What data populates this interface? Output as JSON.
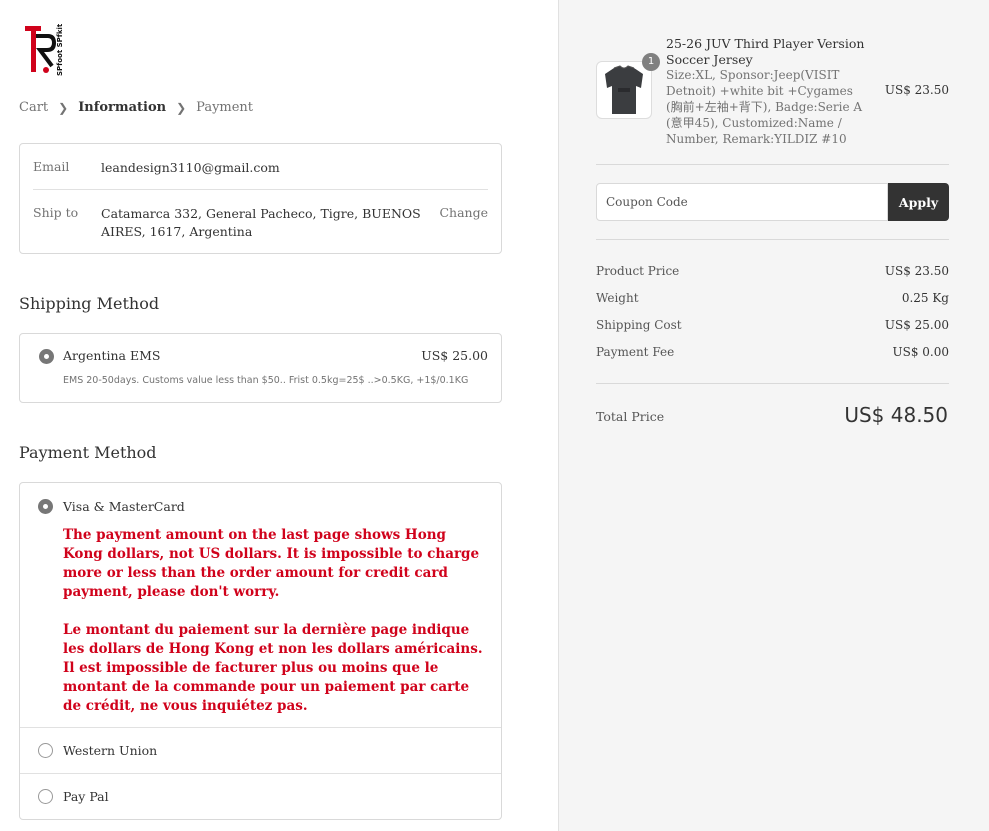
{
  "brand": {
    "logo_text": "SPORT SPfoot",
    "accent": "#d0021b"
  },
  "breadcrumb": {
    "items": [
      "Cart",
      "Information",
      "Payment"
    ],
    "active_index": 1
  },
  "info": {
    "email_label": "Email",
    "email_value": "leandesign3110@gmail.com",
    "ship_label": "Ship to",
    "ship_value_line1": "Catamarca 332, General Pacheco, Tigre, BUENOS",
    "ship_value_line2": "AIRES, 1617, Argentina",
    "change_label": "Change"
  },
  "shipping": {
    "title": "Shipping Method",
    "option": {
      "name": "Argentina EMS",
      "price": "US$ 25.00",
      "description": "EMS 20-50days. Customs value less than $50.. Frist 0.5kg=25$ ..>0.5KG, +1$/0.1KG",
      "selected": true
    }
  },
  "payment": {
    "title": "Payment Method",
    "options": [
      {
        "label": "Visa & MasterCard",
        "selected": true
      },
      {
        "label": "Western Union",
        "selected": false
      },
      {
        "label": "Pay Pal",
        "selected": false
      }
    ],
    "notice_en": "The payment amount on the last page shows Hong Kong dollars, not US dollars. It is impossible to charge more or less than the order amount for credit card payment, please don't worry.",
    "notice_fr": "Le montant du paiement sur la dernière page indique les dollars de Hong Kong et non les dollars américains. Il est impossible de facturer plus ou moins que le montant de la commande pour un paiement par carte de crédit, ne vous inquiétez pas."
  },
  "order": {
    "product": {
      "quantity": "1",
      "title": "25-26 JUV Third Player Version Soccer Jersey",
      "description": "Size:XL, Sponsor:Jeep(VISIT Detnoit) +white bit +Cygames (胸前+左袖+背下), Badge:Serie A (意甲45), Customized:Name / Number, Remark:YILDIZ #10",
      "price": "US$ 23.50"
    },
    "coupon_placeholder": "Coupon Code",
    "apply_label": "Apply",
    "summary": [
      {
        "label": "Product Price",
        "value": "US$ 23.50"
      },
      {
        "label": "Weight",
        "value": "0.25 Kg"
      },
      {
        "label": "Shipping Cost",
        "value": "US$ 25.00"
      },
      {
        "label": "Payment Fee",
        "value": "US$ 0.00"
      }
    ],
    "total_label": "Total Price",
    "total_value": "US$ 48.50"
  }
}
